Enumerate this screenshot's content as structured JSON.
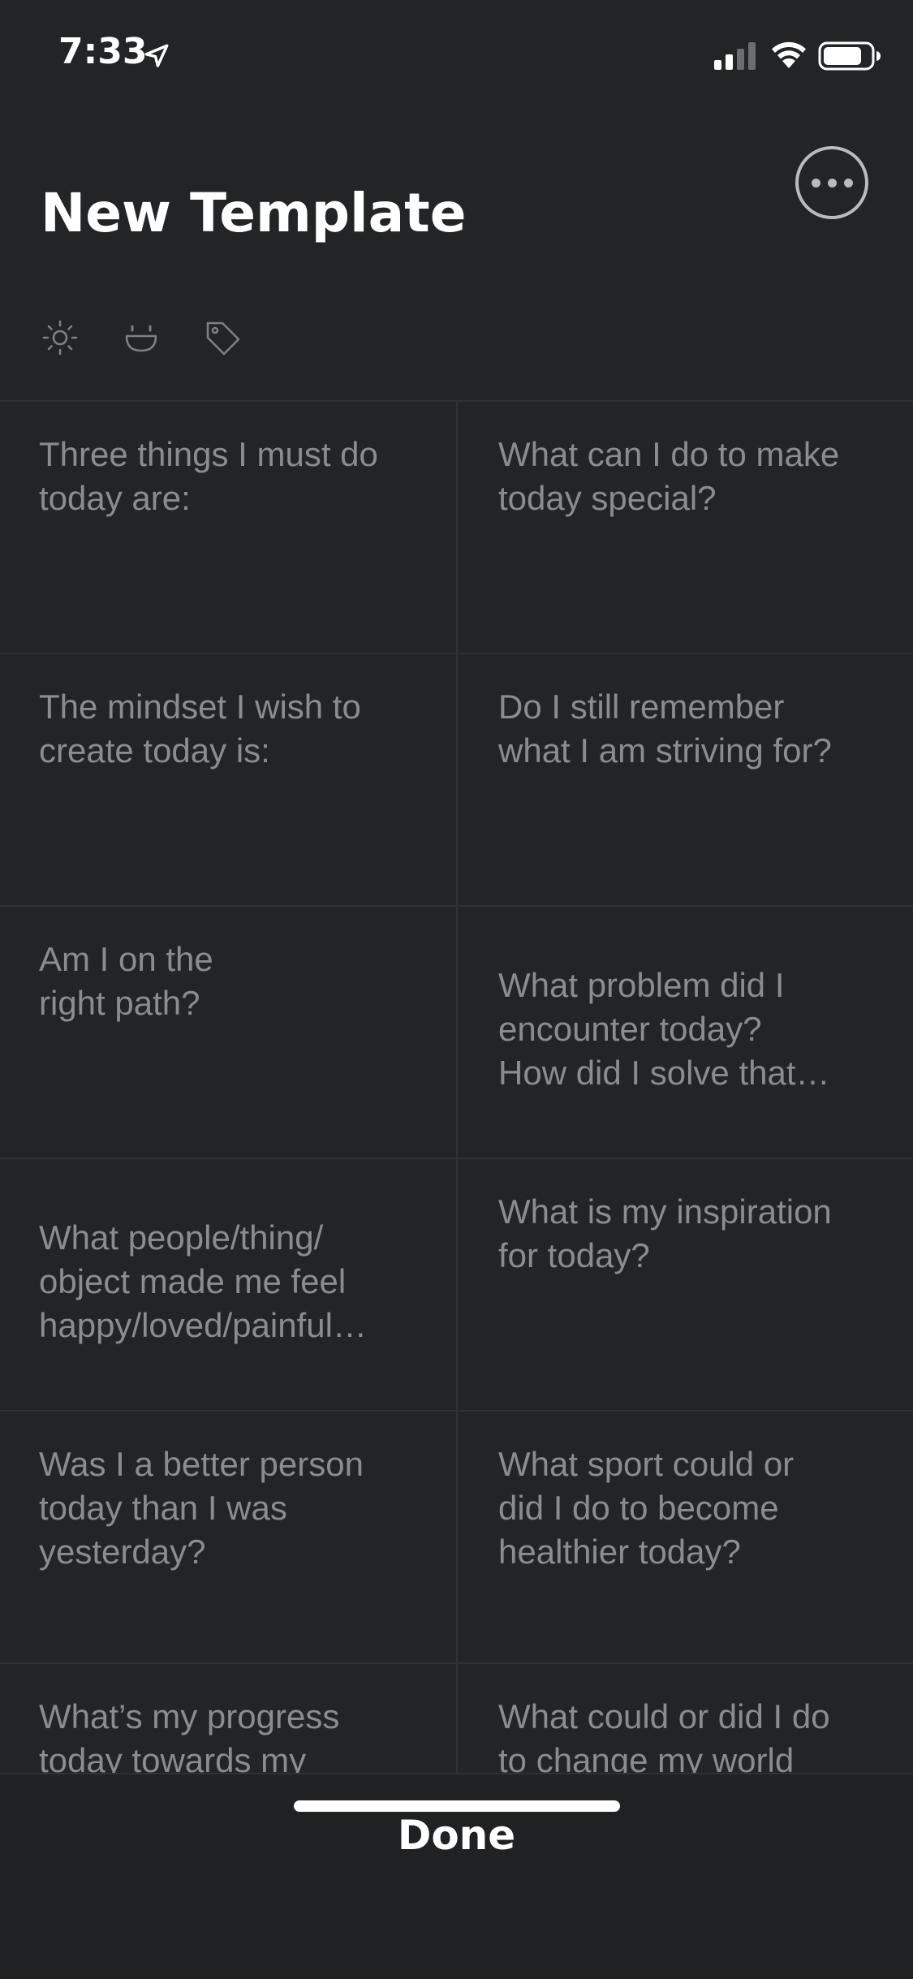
{
  "status_bar": {
    "time": "7:33",
    "icons": [
      "location-arrow-icon",
      "cellular-signal-icon",
      "wifi-icon",
      "battery-icon"
    ]
  },
  "header": {
    "title": "New Template",
    "more_icon": "ellipsis-circle-icon",
    "meta_icons": [
      "sun-icon",
      "smiley-icon",
      "tag-icon"
    ]
  },
  "prompts": [
    [
      "Three things I must do\ntoday are:",
      "What can I do to make\ntoday special?"
    ],
    [
      "The mindset I wish to\ncreate today is:",
      "Do I still remember\nwhat I am striving for?"
    ],
    [
      "Am I on the\nright path?",
      "What problem did I\nencounter today?\nHow did I solve that…"
    ],
    [
      "What people/thing/\nobject made me feel\nhappy/loved/painful…",
      "What is my inspiration\nfor today?"
    ],
    [
      "Was I a better person\ntoday than I was\nyesterday?",
      "What sport could or\ndid I do to become\nhealthier today?"
    ],
    [
      "What’s my progress\ntoday towards my",
      "What could or did I do\nto change my world"
    ]
  ],
  "footer": {
    "done_label": "Done"
  },
  "colors": {
    "background": "#222426",
    "prompt_text": "#8a8d90",
    "divider": "#2f3234"
  }
}
